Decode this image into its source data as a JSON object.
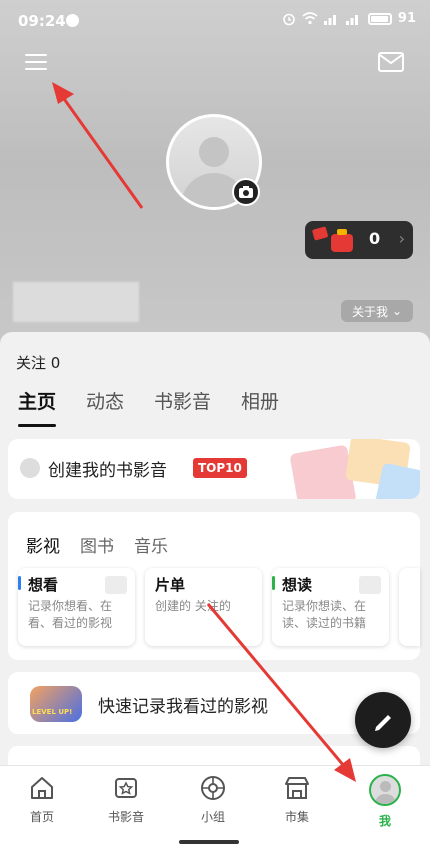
{
  "status_bar": {
    "time": "09:24",
    "battery": "91"
  },
  "header": {
    "menu_icon": "hamburger-menu-icon",
    "mail_icon": "mail-icon",
    "gift_count": "0",
    "about_button": "关于我",
    "about_chevron": "⌄"
  },
  "profile": {
    "follow_text": "关注 0",
    "tabs": [
      {
        "label": "主页",
        "active": true
      },
      {
        "label": "动态",
        "active": false
      },
      {
        "label": "书影音",
        "active": false
      },
      {
        "label": "相册",
        "active": false
      }
    ]
  },
  "create_card": {
    "text": "创建我的书影音",
    "badge": "TOP10"
  },
  "media_card": {
    "tabs": [
      "影视",
      "图书",
      "音乐"
    ],
    "subcards": [
      {
        "title": "想看",
        "desc": "记录你想看、在看、看过的影视",
        "bar_color": "#2f80ed"
      },
      {
        "title": "片单",
        "desc": "创建的 关注的",
        "bar_color": "#ffffff"
      },
      {
        "title": "想读",
        "desc": "记录你想读、在读、读过的书籍",
        "bar_color": "#2bb24c"
      }
    ]
  },
  "quick_card": {
    "text": "快速记录我看过的影视",
    "badge_label": "LEVEL UP!"
  },
  "bottom_nav": {
    "items": [
      {
        "label": "首页",
        "icon": "home-icon",
        "active": false
      },
      {
        "label": "书影音",
        "icon": "star-card-icon",
        "active": false
      },
      {
        "label": "小组",
        "icon": "group-icon",
        "active": false
      },
      {
        "label": "市集",
        "icon": "shop-icon",
        "active": false
      },
      {
        "label": "我",
        "icon": "avatar-icon",
        "active": true
      }
    ]
  },
  "colors": {
    "accent_green": "#2bb24c",
    "annotation_red": "#e53935",
    "badge_red": "#e53935"
  }
}
